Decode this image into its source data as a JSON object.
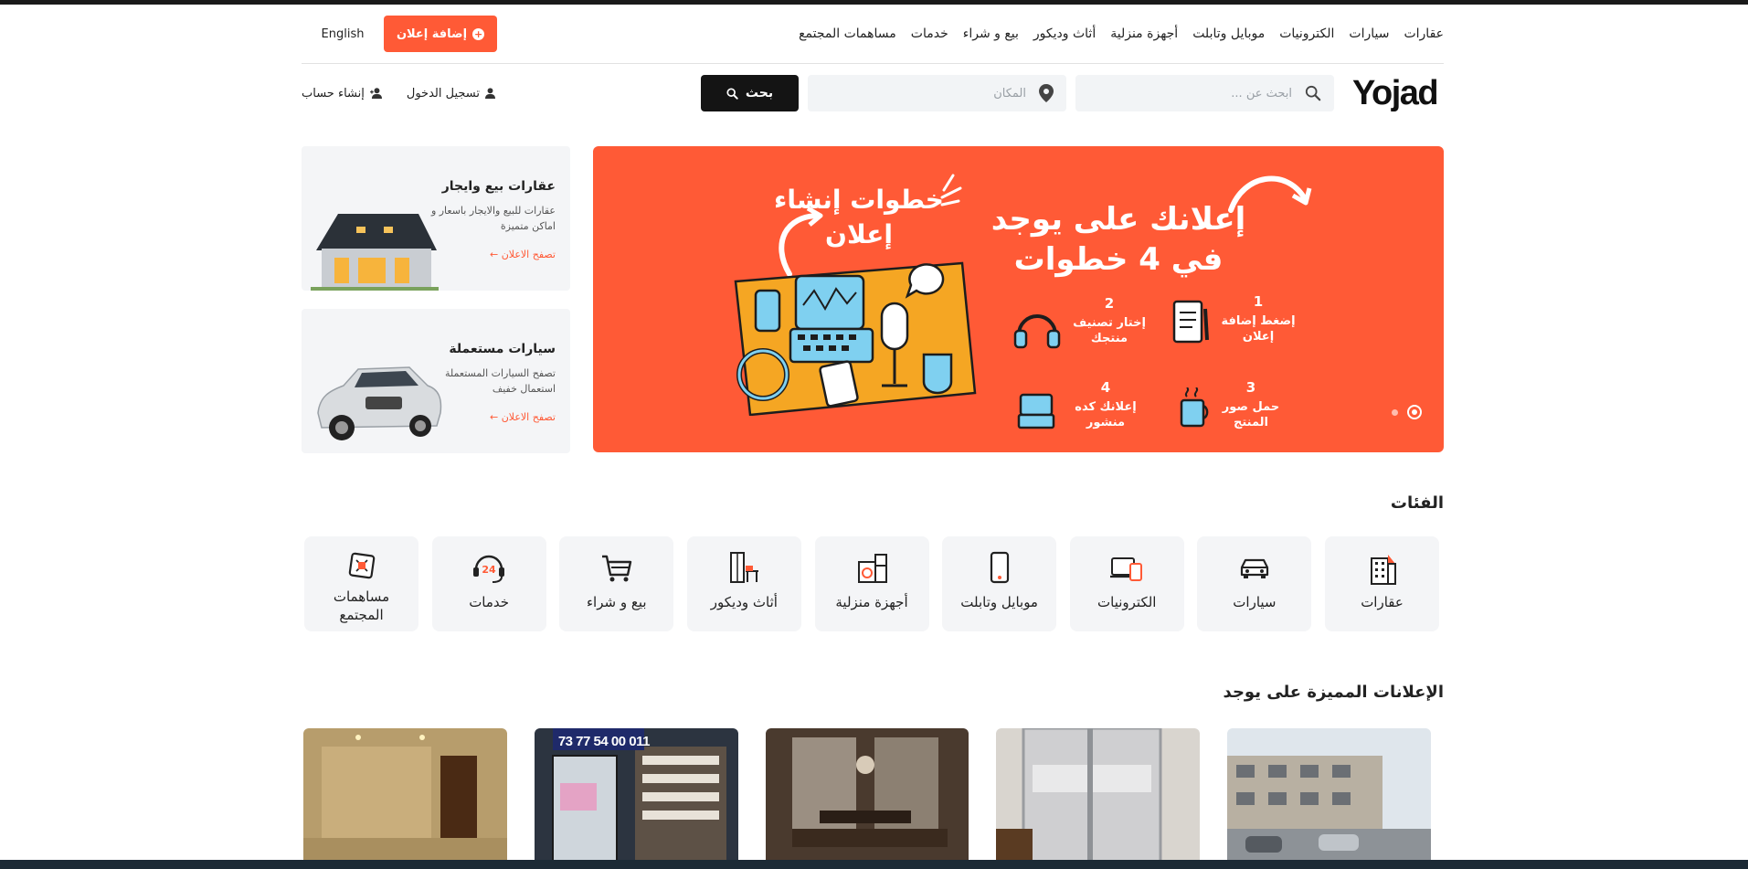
{
  "nav": {
    "lang": "English",
    "post_ad": "إضافة إعلان",
    "links": [
      "عقارات",
      "سيارات",
      "الكترونيات",
      "موبايل وتابلت",
      "أجهزة منزلية",
      "أثاث وديكور",
      "بيع و شراء",
      "خدمات",
      "مساهمات المجتمع"
    ]
  },
  "header": {
    "logo": "Yojad",
    "search_placeholder": "ابحث عن ...",
    "location_placeholder": "المكان",
    "search_button": "بحث",
    "login": "تسجيل الدخول",
    "register": "إنشاء حساب"
  },
  "hero": {
    "headline": "إعلانك على يوجد في 4 خطوات",
    "subhead": "خطوات إنشاء إعلان",
    "steps": [
      {
        "num": "1",
        "text": "إضغط إضافة إعلان"
      },
      {
        "num": "2",
        "text": "إختار تصنيف منتجك"
      },
      {
        "num": "3",
        "text": "حمل صور المنتج"
      },
      {
        "num": "4",
        "text": "إعلانك كده منشور"
      }
    ],
    "accent": "#ff5a36"
  },
  "side_cards": [
    {
      "title": "عقارات بيع وايجار",
      "desc": "عقارات للبيع والايجار باسعار و اماكن متميزة",
      "link": "تصفح الاعلان ←"
    },
    {
      "title": "سيارات مستعملة",
      "desc": "تصفح السيارات المستعملة استعمال خفيف",
      "link": "تصفح الاعلان ←"
    }
  ],
  "categories": {
    "title": "الفئات",
    "items": [
      {
        "label": "عقارات",
        "icon": "building-icon"
      },
      {
        "label": "سيارات",
        "icon": "car-icon"
      },
      {
        "label": "الكترونيات",
        "icon": "devices-icon"
      },
      {
        "label": "موبايل وتابلت",
        "icon": "mobile-icon"
      },
      {
        "label": "أجهزة منزلية",
        "icon": "appliances-icon"
      },
      {
        "label": "أثاث وديكور",
        "icon": "furniture-icon"
      },
      {
        "label": "بيع و شراء",
        "icon": "cart-icon"
      },
      {
        "label": "خدمات",
        "icon": "support-24-icon"
      },
      {
        "label": "مساهمات المجتمع",
        "icon": "community-icon"
      }
    ]
  },
  "featured": {
    "title": "الإعلانات المميزة على يوجد",
    "phone_overlay": "011 00 54 77 73"
  }
}
